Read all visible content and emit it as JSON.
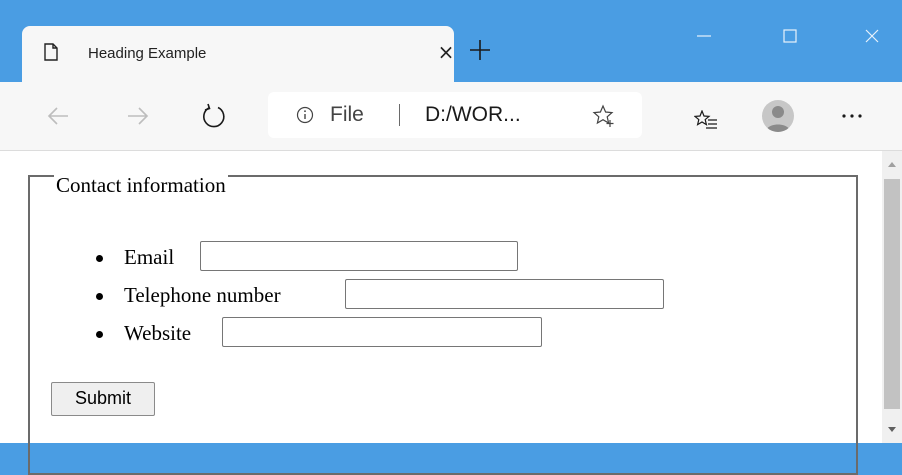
{
  "browser": {
    "tab": {
      "title": "Heading Example",
      "close_glyph": "×",
      "icon": "page-icon"
    },
    "new_tab_icon": "plus-icon",
    "window_controls": [
      "minimize-icon",
      "maximize-icon",
      "close-icon"
    ],
    "toolbar": {
      "back_icon": "arrow-left-icon",
      "forward_icon": "arrow-right-icon",
      "refresh_icon": "refresh-icon",
      "address": {
        "info_icon": "info-icon",
        "scheme_label": "File",
        "url": "D:/WOR...",
        "favorite_add_icon": "star-plus-icon"
      },
      "favorites_icon": "favorites-list-icon",
      "profile_icon": "avatar-icon",
      "more_icon": "more-icon"
    },
    "colors": {
      "titlebar": "#4a9de3",
      "toolbar": "#f7f7f7",
      "fieldset_border": "#6b6b6b"
    }
  },
  "form": {
    "legend": "Contact information",
    "fields": [
      {
        "label": "Email",
        "value": "",
        "placeholder": ""
      },
      {
        "label": "Telephone number",
        "value": "",
        "placeholder": ""
      },
      {
        "label": "Website",
        "value": "",
        "placeholder": ""
      }
    ],
    "submit_label": "Submit"
  }
}
